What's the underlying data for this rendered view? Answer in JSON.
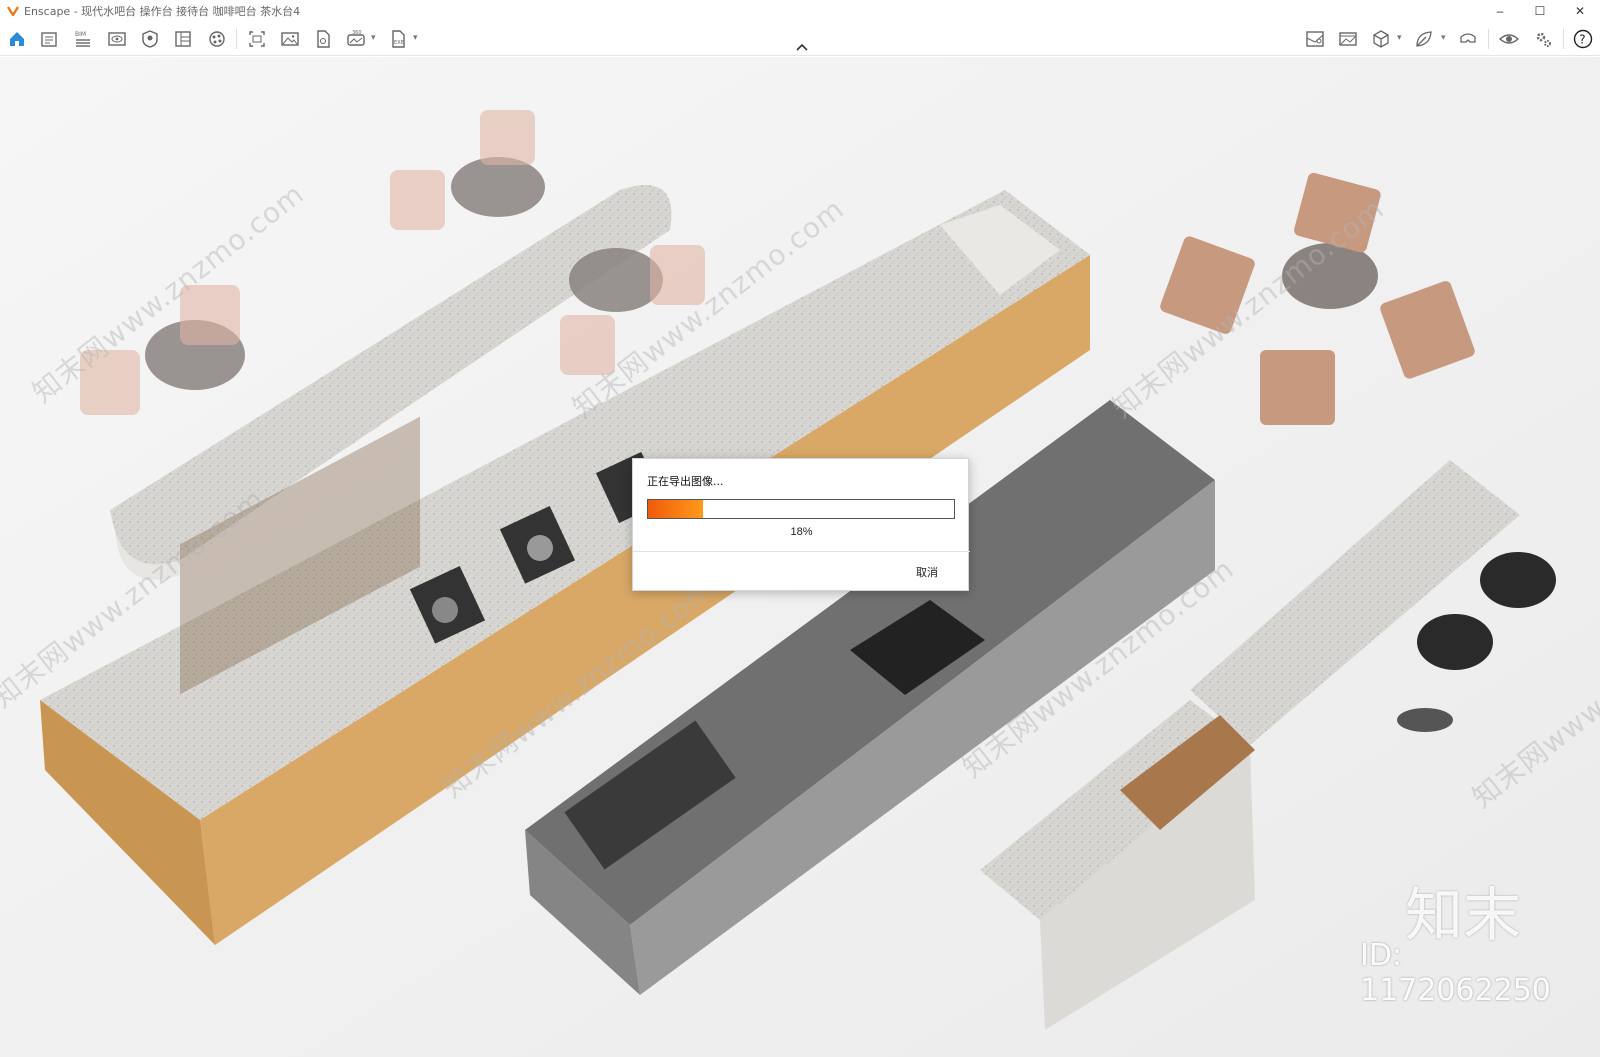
{
  "window": {
    "title": "Enscape - 现代水吧台 操作台 接待台 咖啡吧台 茶水台4",
    "controls": {
      "minimize": "–",
      "maximize": "☐",
      "close": "✕"
    }
  },
  "toolbar": {
    "left_icons": [
      "home-icon",
      "asset-library-icon",
      "bim-info-icon",
      "view-management-icon",
      "render-settings-icon",
      "batch-render-icon",
      "material-icon",
      "screenshot-icon",
      "image-export-icon",
      "pdf-export-icon",
      "panorama-360-icon",
      "exe-export-icon"
    ],
    "bim_label": "BIM",
    "pano_label": "360",
    "exe_label": "EXE",
    "right_icons": [
      "map-icon",
      "image-gallery-icon",
      "cube-icon",
      "leaf-icon",
      "vr-headset-icon",
      "eye-icon",
      "settings-icon",
      "help-icon"
    ],
    "help_label": "?"
  },
  "dialog": {
    "title": "正在导出图像...",
    "progress_percent": 18,
    "progress_label": "18%",
    "cancel_label": "取消"
  },
  "watermarks": {
    "site": "知末网www.znzmo.com",
    "brand": "知末",
    "id": "ID: 1172062250"
  },
  "colors": {
    "accent_orange": "#f07a1a",
    "home_blue": "#2a8bd8",
    "progress_start": "#f05a0a",
    "progress_end": "#ff9a1c"
  }
}
